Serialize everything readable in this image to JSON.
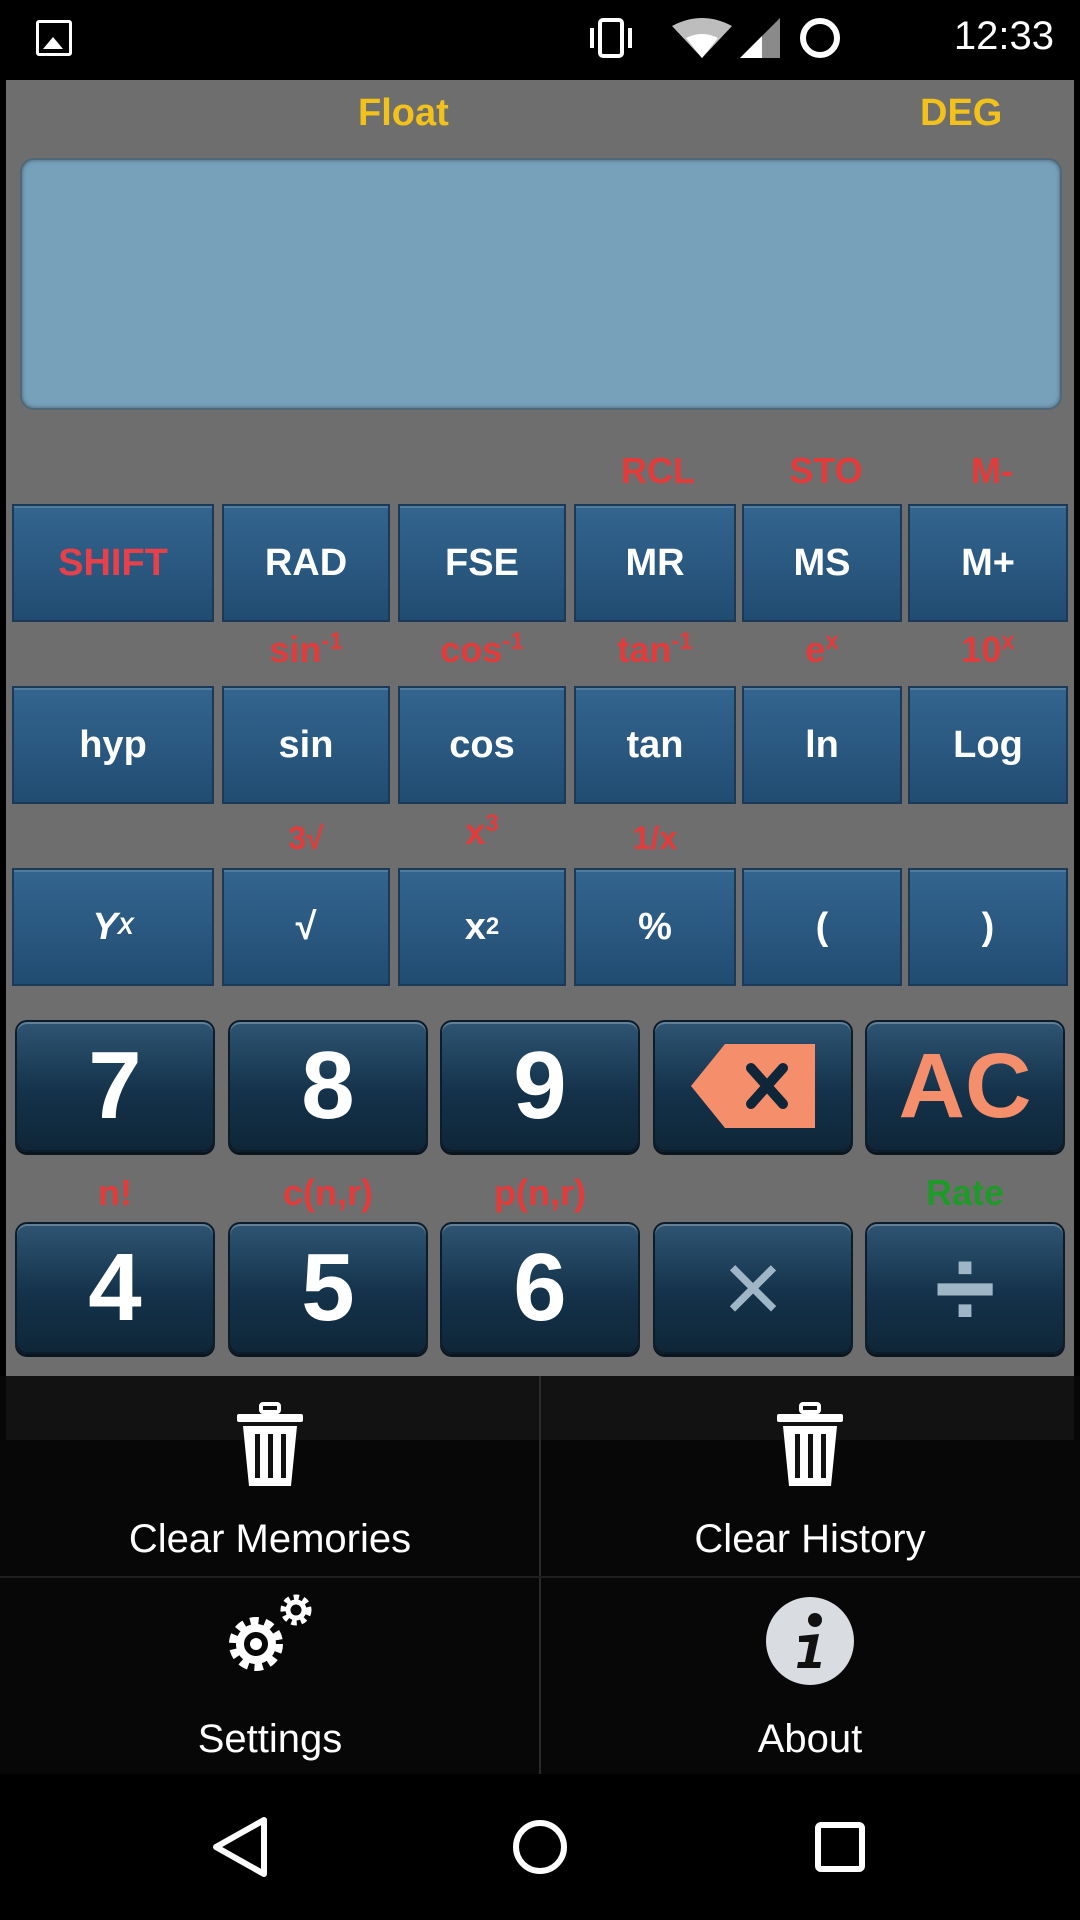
{
  "status_bar": {
    "time": "12:33",
    "icons": [
      "image-icon",
      "vibrate-icon",
      "wifi-icon",
      "signal-icon",
      "battery-circle-icon"
    ]
  },
  "calculator": {
    "mode_left": "Float",
    "mode_right": "DEG",
    "display_value": "",
    "row1_sublabels": [
      "",
      "",
      "",
      "RCL",
      "STO",
      "M-"
    ],
    "row1": [
      "SHIFT",
      "RAD",
      "FSE",
      "MR",
      "MS",
      "M+"
    ],
    "row2_sublabels": [
      {
        "base": "",
        "sup": ""
      },
      {
        "base": "sin",
        "sup": "-1"
      },
      {
        "base": "cos",
        "sup": "-1"
      },
      {
        "base": "tan",
        "sup": "-1"
      },
      {
        "base": "e",
        "sup": "x"
      },
      {
        "base": "10",
        "sup": "x"
      }
    ],
    "row2": [
      "hyp",
      "sin",
      "cos",
      "tan",
      "ln",
      "Log"
    ],
    "row3_sublabels": [
      {
        "base": "",
        "sup": ""
      },
      {
        "base": "3√",
        "sup": ""
      },
      {
        "base": "x",
        "sup": "3"
      },
      {
        "base": "1/x",
        "sup": ""
      },
      {
        "base": "",
        "sup": ""
      },
      {
        "base": "",
        "sup": ""
      }
    ],
    "row3": [
      {
        "base": "Y",
        "sup": "X"
      },
      {
        "base": "√",
        "sup": ""
      },
      {
        "base": "x",
        "sup": "2"
      },
      {
        "base": "%",
        "sup": ""
      },
      {
        "base": "(",
        "sup": ""
      },
      {
        "base": ")",
        "sup": ""
      }
    ],
    "num_row1": [
      "7",
      "8",
      "9",
      "backspace",
      "AC"
    ],
    "num_row2_sublabels": [
      "n!",
      "c(n,r)",
      "p(n,r)",
      "",
      "Rate"
    ],
    "num_row2": [
      "4",
      "5",
      "6",
      "×",
      "÷"
    ]
  },
  "menu": {
    "items": [
      {
        "label": "Clear Memories",
        "icon": "trash-icon"
      },
      {
        "label": "Clear History",
        "icon": "trash-icon"
      },
      {
        "label": "Settings",
        "icon": "gear-icon"
      },
      {
        "label": "About",
        "icon": "info-icon"
      }
    ]
  },
  "nav_bar": {
    "buttons": [
      "back-icon",
      "home-icon",
      "recents-icon"
    ]
  },
  "colors": {
    "app_bg": "#6e6e6e",
    "display_bg": "#77a0ba",
    "mode_text": "#f3c21a",
    "shift_text": "#e23b3b",
    "rate_text": "#1f9a2a",
    "ac_text": "#f58e6a"
  }
}
